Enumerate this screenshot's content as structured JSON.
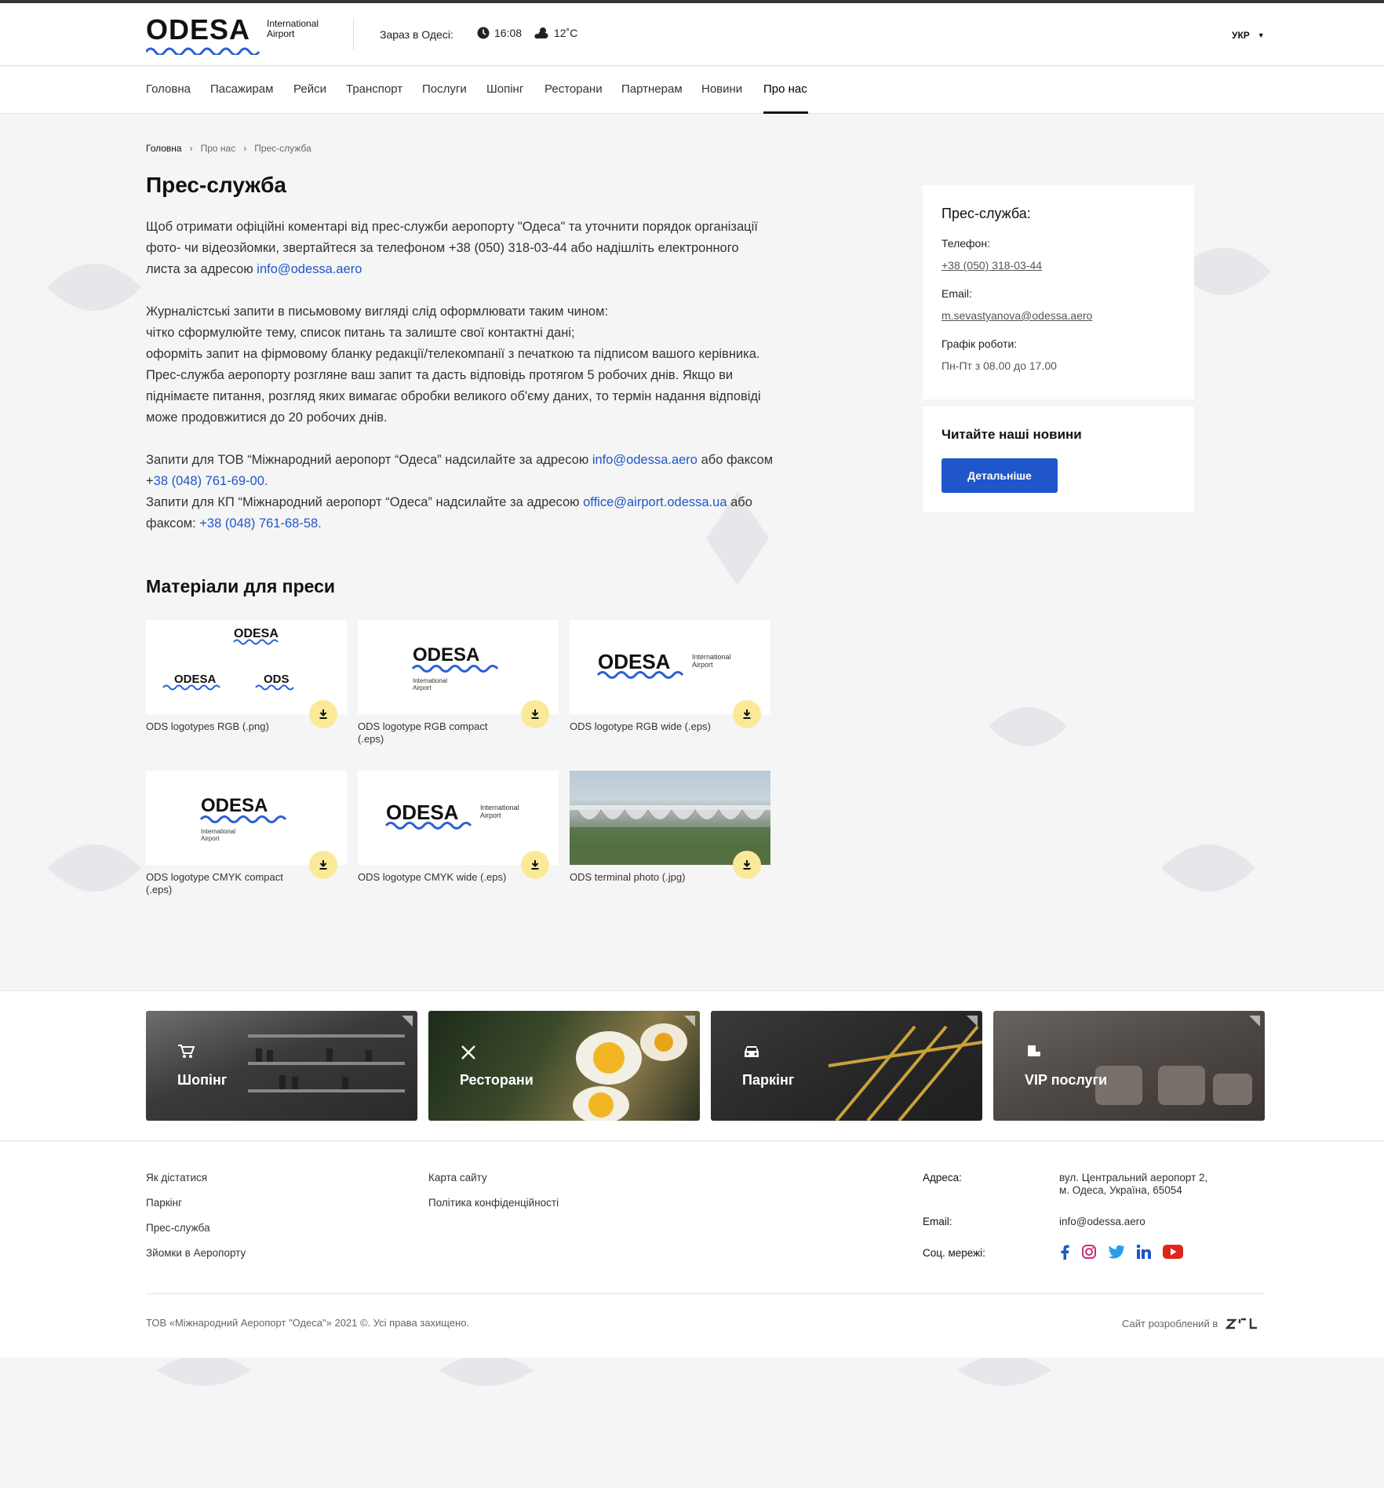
{
  "header": {
    "logo_word": "ODESA",
    "logo_sub_line1": "International",
    "logo_sub_line2": "Airport",
    "now_label": "Зараз в Одесі:",
    "time": "16:08",
    "temperature": "12˚C",
    "language": "УКР"
  },
  "nav": {
    "items": [
      "Головна",
      "Пасажирам",
      "Рейси",
      "Транспорт",
      "Послуги",
      "Шопінг",
      "Ресторани",
      "Партнерам",
      "Новини",
      "Про нас"
    ],
    "active": "Про нас"
  },
  "breadcrumb": [
    "Головна",
    "Про нас",
    "Прес-служба"
  ],
  "page_title": "Прес-служба",
  "content": {
    "p1_text": "Щоб отримати офіційні коментарі від прес-служби аеропорту \"Одеса\" та уточнити порядок організації фото- чи відеозйомки, звертайтеся за телефоном +38 (050) 318-03-44 або надішліть електронного листа за адресою ",
    "p1_link": "info@odessa.aero",
    "p2_lines": [
      "Журналістські запити в письмовому вигляді слід оформлювати таким чином:",
      "чітко сформулюйте тему, список питань та залиште свої контактні дані;",
      "оформіть запит на фірмовому бланку редакції/телекомпанії з печаткою та підписом вашого керівника.",
      "Прес-служба аеропорту розгляне ваш запит та дасть відповідь протягом 5 робочих днів. Якщо ви піднімаєте питання, розгляд яких вимагає обробки великого об'єму даних, то термін надання відповіді може продовжитися до 20 робочих днів."
    ],
    "p3_a": "Запити для ТОВ “Міжнародний аеропорт “Одеса” надсилайте за адресою ",
    "p3_a_link": "info@odessa.aero",
    "p3_b": " або факсом +",
    "p3_b_link": "38 (048) 761-69-00.",
    "p3_c": "Запити для КП “Міжнародний аеропорт “Одеса” надсилайте за адресою ",
    "p3_c_link": "office@airport.odessa.ua",
    "p3_d": " або факсом: ",
    "p3_d_link": "+38 (048) 761-68-58."
  },
  "materials": {
    "title": "Матеріали для преси",
    "items": [
      {
        "label": "ODS logotypes RGB (.png)"
      },
      {
        "label": "ODS logotype RGB compact (.eps)"
      },
      {
        "label": "ODS logotype RGB wide (.eps)"
      },
      {
        "label": "ODS logotype CMYK compact (.eps)"
      },
      {
        "label": "ODS logotype CMYK wide (.eps)"
      },
      {
        "label": "ODS terminal photo (.jpg)"
      }
    ],
    "thumb_logo_word": "ODESA",
    "thumb_logo_short": "ODS",
    "thumb_sub1": "International",
    "thumb_sub2": "Airport"
  },
  "sidebar": {
    "press": {
      "title": "Прес-служба:",
      "phone_label": "Телефон:",
      "phone": "+38 (050) 318-03-44",
      "email_label": "Email:",
      "email": "m.sevastyanova@odessa.aero",
      "hours_label": "Графік роботи:",
      "hours": "Пн-Пт з 08.00 до 17.00"
    },
    "news": {
      "title": "Читайте наші новини",
      "button": "Детальніше"
    }
  },
  "promos": [
    {
      "label": "Шопінг",
      "icon": "cart-icon"
    },
    {
      "label": "Ресторани",
      "icon": "cutlery-icon"
    },
    {
      "label": "Паркінг",
      "icon": "car-icon"
    },
    {
      "label": "VIP послуги",
      "icon": "vip-seat-icon"
    }
  ],
  "footer": {
    "col1": [
      "Як дістатися",
      "Паркінг",
      "Прес-служба",
      "Зйомки в Аеропорту"
    ],
    "col2": [
      "Карта сайту",
      "Політика конфіденційності"
    ],
    "address_label": "Адреса:",
    "address_line1": "вул. Центральний аеропорт 2,",
    "address_line2": "м. Одеса, Україна, 65054",
    "email_label": "Email:",
    "email": "info@odessa.aero",
    "social_label": "Соц. мережі:",
    "social": [
      "facebook-icon",
      "instagram-icon",
      "twitter-icon",
      "linkedin-icon",
      "youtube-icon"
    ],
    "copyright": "ТОВ «Міжнародний Аеропорт \"Одеса\"» 2021 ©. Усі права захищено.",
    "developer": "Сайт розроблений в"
  },
  "colors": {
    "accent": "#1f56c9",
    "download": "#fbe99a",
    "page_bg": "#f5f5f5"
  }
}
